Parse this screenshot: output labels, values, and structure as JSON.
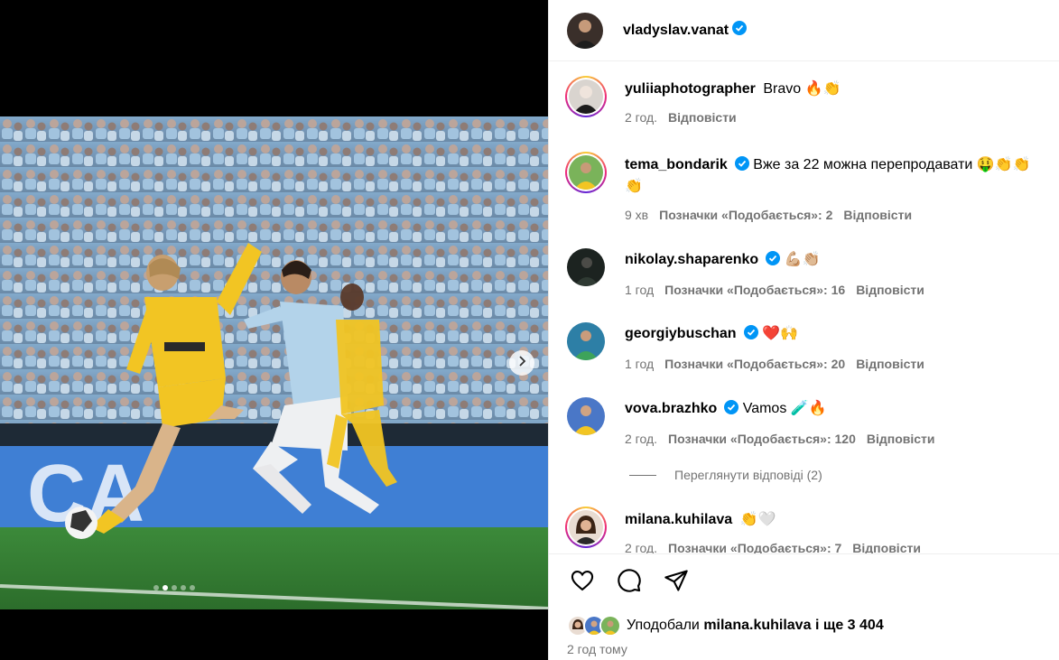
{
  "post": {
    "author": "vladyslav.vanat",
    "author_verified": true
  },
  "comments": [
    {
      "username": "yuliiaphotographer",
      "verified": false,
      "text": "Bravo",
      "emoji": "🔥👏",
      "time": "2 год.",
      "likes_label": "",
      "reply_label": "Відповісти",
      "story_ring": true
    },
    {
      "username": "tema_bondarik",
      "verified": true,
      "text": "Вже за 22 можна перепродавати",
      "emoji": "🤑👏👏",
      "emoji_line2": "👏",
      "time": "9 хв",
      "likes_label": "Позначки «Подобається»: 2",
      "reply_label": "Відповісти",
      "story_ring": true
    },
    {
      "username": "nikolay.shaparenko",
      "verified": true,
      "text": "",
      "emoji": "💪🏼👏🏼",
      "time": "1 год",
      "likes_label": "Позначки «Подобається»: 16",
      "reply_label": "Відповісти",
      "story_ring": false
    },
    {
      "username": "georgiybuschan",
      "verified": true,
      "text": "",
      "emoji": "❤️🙌",
      "time": "1 год",
      "likes_label": "Позначки «Подобається»: 20",
      "reply_label": "Відповісти",
      "story_ring": false
    },
    {
      "username": "vova.brazhko",
      "verified": true,
      "text": "Vamos",
      "emoji": "🧪🔥",
      "time": "2 год.",
      "likes_label": "Позначки «Подобається»: 120",
      "reply_label": "Відповісти",
      "story_ring": false
    },
    {
      "username": "milana.kuhilava",
      "verified": false,
      "text": "",
      "emoji": "👏🤍",
      "time": "2 год.",
      "likes_label": "Позначки «Подобається»: 7",
      "reply_label": "Відповісти",
      "story_ring": true
    }
  ],
  "view_replies": "Переглянути відповіді (2)",
  "likes": {
    "prefix": "Уподобали",
    "first_user": "milana.kuhilava",
    "suffix": "і ще 3 404"
  },
  "timestamp": "2 год тому",
  "carousel": {
    "total": 5,
    "active": 1
  },
  "colors": {
    "verified": "#0095f6",
    "meta_text": "#737373",
    "jersey_yellow": "#f2c523",
    "opponent_blue": "#b3d3ea"
  },
  "icons": {
    "like": "heart-outline-icon",
    "comment": "speech-bubble-icon",
    "share": "paper-plane-icon",
    "next": "chevron-right-icon"
  }
}
